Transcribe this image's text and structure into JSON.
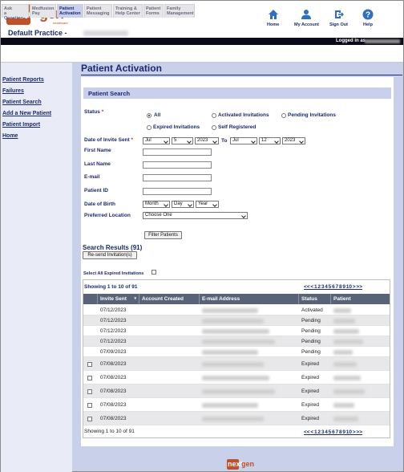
{
  "brand": {
    "logo_part1": "next",
    "logo_part2": "gen",
    "logo_sub": "healthcare"
  },
  "header": {
    "practice": "Default Practice -",
    "logged_in": "Logged in as",
    "nav": [
      {
        "label": "Home",
        "icon": "house-icon"
      },
      {
        "label": "My Account",
        "icon": "person-icon"
      },
      {
        "label": "Sign Out",
        "icon": "sign-out-icon"
      },
      {
        "label": "Help",
        "icon": "help-icon"
      }
    ]
  },
  "tabs": [
    {
      "line1": "Ask",
      "line2": "a Question"
    },
    {
      "line1": "Medfusion",
      "line2": "Pay"
    },
    {
      "line1": "Patient",
      "line2": "Activation"
    },
    {
      "line1": "Patient",
      "line2": "Messaging"
    },
    {
      "line1": "Training &",
      "line2": "Help Center"
    },
    {
      "line1": "Patient",
      "line2": "Forms"
    },
    {
      "line1": "Family",
      "line2": "Management"
    }
  ],
  "sidebar": {
    "items": [
      "Patient Reports",
      "Failures",
      "Patient Search",
      "Add a New Patient",
      "Patient Import",
      "Home"
    ]
  },
  "page": {
    "title": "Patient Activation",
    "section": "Patient Search"
  },
  "form": {
    "status_label": "Status",
    "required_mark": "*",
    "status_options": [
      "All",
      "Activated Invitations",
      "Pending Invitations",
      "Expired Invitations",
      "Self Registered"
    ],
    "invite_label": "Date of Invite Sent",
    "to_label": "To",
    "from_month": "Jul",
    "from_day": "5",
    "from_year": "2023",
    "to_month": "Jul",
    "to_day": "12",
    "to_year": "2023",
    "first_name": "First Name",
    "last_name": "Last Name",
    "email": "E-mail",
    "patient_id": "Patient ID",
    "dob": "Date of Birth",
    "dob_month": "Month",
    "dob_day": "Day",
    "dob_year": "Year",
    "location": "Preferred Location",
    "location_value": "Choose One",
    "filter_button": "Filter Patients"
  },
  "results": {
    "title": "Search Results (91)",
    "resend_button": "Re-send Invitation(s)",
    "select_all": "Select All Expired Invitations",
    "showing": "Showing 1 to 10 of 91",
    "pager_text": "<< < 1 2 3 4 5 6 7 8 9 10 > >>",
    "columns": [
      "Invite Sent",
      "Account Created",
      "E-mail Address",
      "Status",
      "Patient"
    ],
    "rows": [
      {
        "date": "07/12/2023",
        "status": "Activated"
      },
      {
        "date": "07/12/2023",
        "status": "Pending"
      },
      {
        "date": "07/12/2023",
        "status": "Pending"
      },
      {
        "date": "07/12/2023",
        "status": "Pending"
      },
      {
        "date": "07/09/2023",
        "status": "Pending"
      },
      {
        "date": "07/08/2023",
        "status": "Expired"
      },
      {
        "date": "07/08/2023",
        "status": "Expired"
      },
      {
        "date": "07/08/2023",
        "status": "Expired"
      },
      {
        "date": "07/08/2023",
        "status": "Expired"
      },
      {
        "date": "07/08/2023",
        "status": "Expired"
      }
    ]
  }
}
